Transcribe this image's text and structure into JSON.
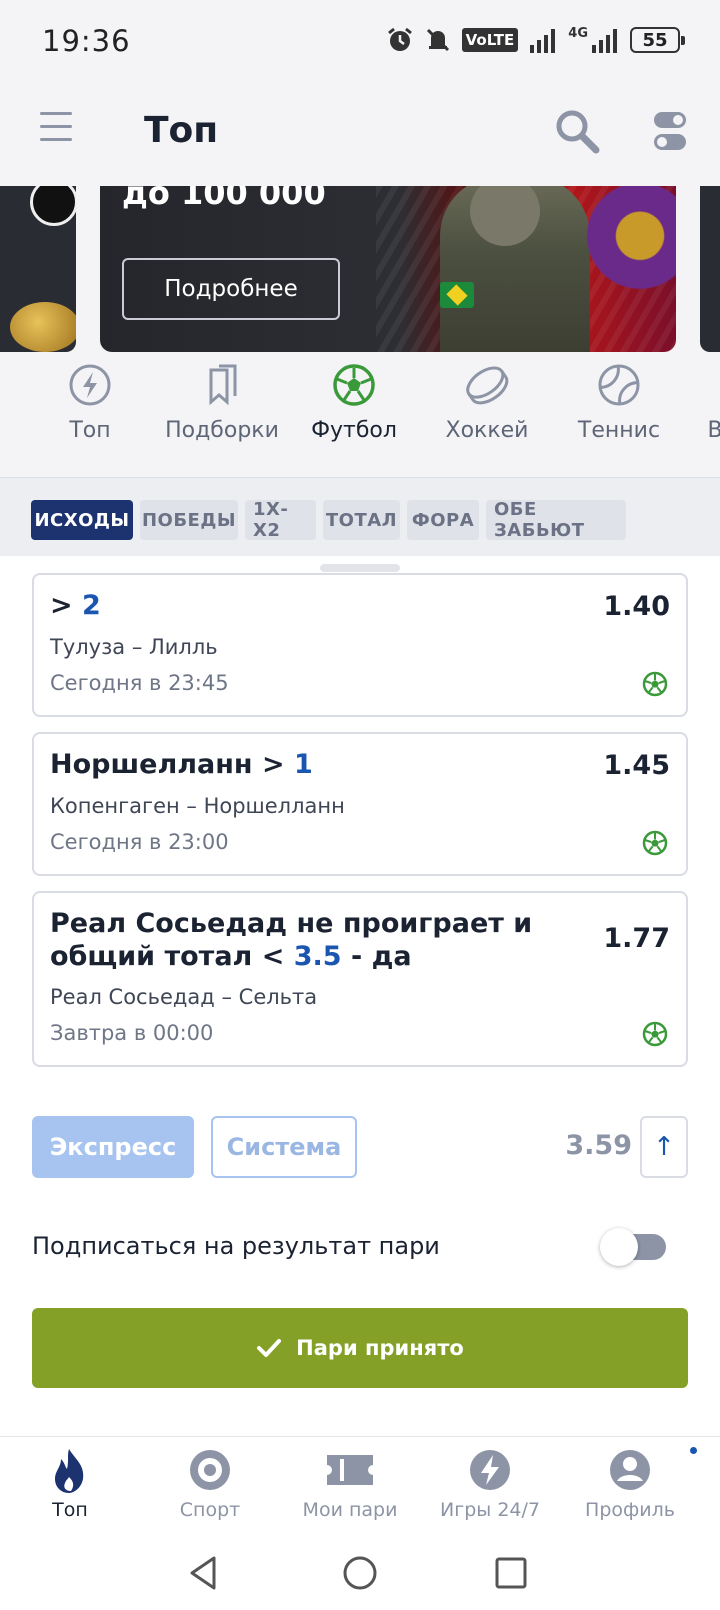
{
  "status_bar": {
    "time": "19:36",
    "volte_label": "VoLTE",
    "network": "4G",
    "battery": "55",
    "icons": [
      "alarm-icon",
      "mute-icon",
      "signal-icon",
      "signal-icon",
      "battery-icon"
    ]
  },
  "header": {
    "title": "Топ",
    "menu_icon": "menu-icon",
    "search_icon": "search-icon",
    "settings_icon": "toggle-settings-icon"
  },
  "banner": {
    "title": "до 100 000",
    "button_label": "Подробнее"
  },
  "sports": [
    {
      "label": "Топ",
      "icon": "lightning-icon",
      "active": false
    },
    {
      "label": "Подборки",
      "icon": "bookmark-icon",
      "active": false
    },
    {
      "label": "Футбол",
      "icon": "football-icon",
      "active": true
    },
    {
      "label": "Хоккей",
      "icon": "hockey-puck-icon",
      "active": false
    },
    {
      "label": "Теннис",
      "icon": "tennis-ball-icon",
      "active": false
    },
    {
      "label": "В",
      "icon": "",
      "active": false
    }
  ],
  "filters": [
    {
      "label": "ИСХОДЫ",
      "active": true
    },
    {
      "label": "ПОБЕДЫ",
      "active": false
    },
    {
      "label": "1Х-Х2",
      "active": false
    },
    {
      "label": "ТОТАЛ",
      "active": false
    },
    {
      "label": "ФОРА",
      "active": false
    },
    {
      "label": "ОБЕ ЗАБЬЮТ",
      "active": false
    }
  ],
  "bets": [
    {
      "title_prefix": "> ",
      "title_highlight": "2",
      "odds": "1.40",
      "match": "Тулуза – Лилль",
      "time": "Сегодня в 23:45"
    },
    {
      "title_prefix": "Норшелланн > ",
      "title_highlight": "1",
      "odds": "1.45",
      "match": "Копенгаген – Норшелланн",
      "time": "Сегодня в 23:00"
    },
    {
      "title_line1": "Реал Сосьедад не проиграет и",
      "title_line2_prefix": "общий тотал < ",
      "title_line2_highlight": "3.5",
      "title_line2_suffix": " - да",
      "odds": "1.77",
      "match": "Реал Сосьедад – Сельта",
      "time": "Завтра в 00:00"
    }
  ],
  "slip": {
    "express_label": "Экспресс",
    "system_label": "Система",
    "total_odds": "3.59",
    "collapse_glyph": "↑",
    "subscribe_label": "Подписаться на результат пари",
    "subscribe_on": false,
    "accepted_label": "Пари принято"
  },
  "bottom_nav": [
    {
      "label": "Топ",
      "icon": "flame-icon",
      "active": true
    },
    {
      "label": "Спорт",
      "icon": "target-icon",
      "active": false
    },
    {
      "label": "Мои пари",
      "icon": "ticket-icon",
      "active": false
    },
    {
      "label": "Игры 24/7",
      "icon": "lightning-circle-icon",
      "active": false
    },
    {
      "label": "Профиль",
      "icon": "profile-icon",
      "active": false
    }
  ],
  "colors": {
    "brand_navy": "#1d3370",
    "accent_blue": "#1a56b0",
    "football_green": "#3a9a3a",
    "accepted_green": "#85a026",
    "disabled_blue": "#a7c3ef"
  }
}
